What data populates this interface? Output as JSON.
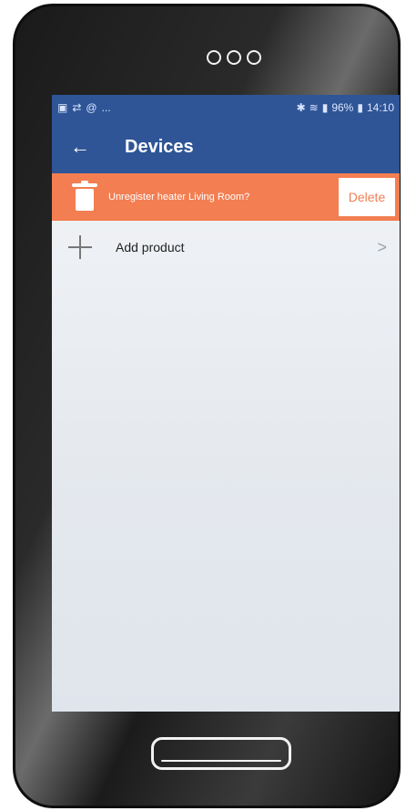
{
  "status_bar": {
    "left_icons": [
      "image-icon",
      "sync-icon",
      "at-icon",
      "more-icon"
    ],
    "right_text": "96%",
    "time": "14:10",
    "battery_label": "96%",
    "dots": "..."
  },
  "appbar": {
    "back_symbol": "←",
    "title": "Devices",
    "bg": "#2F5597"
  },
  "alert": {
    "text": "Unregister heater Living Room?",
    "delete_label": "Delete",
    "bg": "#F27E52"
  },
  "list": {
    "add_label": "Add product",
    "chevron": ">"
  }
}
